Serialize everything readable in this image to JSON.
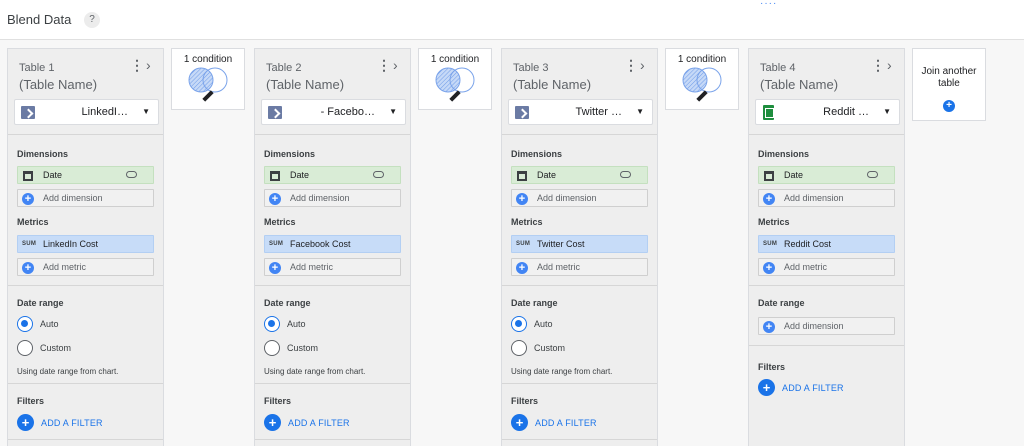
{
  "header": {
    "title": "Blend Data",
    "help_icon": "?",
    "dots": "····"
  },
  "tables": [
    {
      "title": "Table 1",
      "name": "(Table Name)",
      "source": "LinkedI…",
      "source_icon": "connector-icon",
      "dim_label": "Dimensions",
      "dim": "Date",
      "add_dim": "Add dimension",
      "met_label": "Metrics",
      "metric_badge": "SUM",
      "metric": "LinkedIn Cost",
      "add_met": "Add metric"
    },
    {
      "title": "Table 2",
      "name": "(Table Name)",
      "source": "- Facebo…",
      "source_icon": "connector-icon",
      "dim_label": "Dimensions",
      "dim": "Date",
      "add_dim": "Add dimension",
      "met_label": "Metrics",
      "metric_badge": "SUM",
      "metric": "Facebook Cost",
      "add_met": "Add metric"
    },
    {
      "title": "Table 3",
      "name": "(Table Name)",
      "source": "Twitter …",
      "source_icon": "connector-icon",
      "dim_label": "Dimensions",
      "dim": "Date",
      "add_dim": "Add dimension",
      "met_label": "Metrics",
      "metric_badge": "SUM",
      "metric": "Twitter Cost",
      "add_met": "Add metric"
    },
    {
      "title": "Table 4",
      "name": "(Table Name)",
      "source": "Reddit …",
      "source_icon": "sheets-icon",
      "dim_label": "Dimensions",
      "dim": "Date",
      "add_dim": "Add dimension",
      "met_label": "Metrics",
      "metric_badge": "SUM",
      "metric": "Reddit Cost",
      "add_met": "Add metric"
    }
  ],
  "date_range": {
    "label": "Date range",
    "auto": "Auto",
    "custom": "Custom",
    "note": "Using date range from chart.",
    "add_dimension": "Add dimension"
  },
  "filters": {
    "label": "Filters",
    "add": "ADD A FILTER"
  },
  "joins": [
    {
      "label": "1 condition"
    },
    {
      "label": "1 condition"
    },
    {
      "label": "1 condition"
    }
  ],
  "add_table": {
    "label_line1": "Join another",
    "label_line2": "table"
  }
}
